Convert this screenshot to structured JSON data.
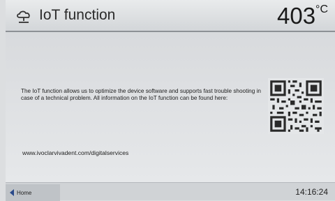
{
  "header": {
    "title": "IoT function",
    "temperature": "403",
    "temperature_unit": "°C",
    "icon": "cloud-network-icon"
  },
  "content": {
    "description": "The IoT function allows us to optimize the device software and supports fast trouble shooting in case of a technical problem. All information on the IoT function can be found here:",
    "link": "www.ivoclarvivadent.com/digitalservices",
    "qr_icon": "qr-code-icon"
  },
  "footer": {
    "home_label": "Home",
    "time": "14:16:24"
  },
  "colors": {
    "accent": "#2a4a8a"
  }
}
